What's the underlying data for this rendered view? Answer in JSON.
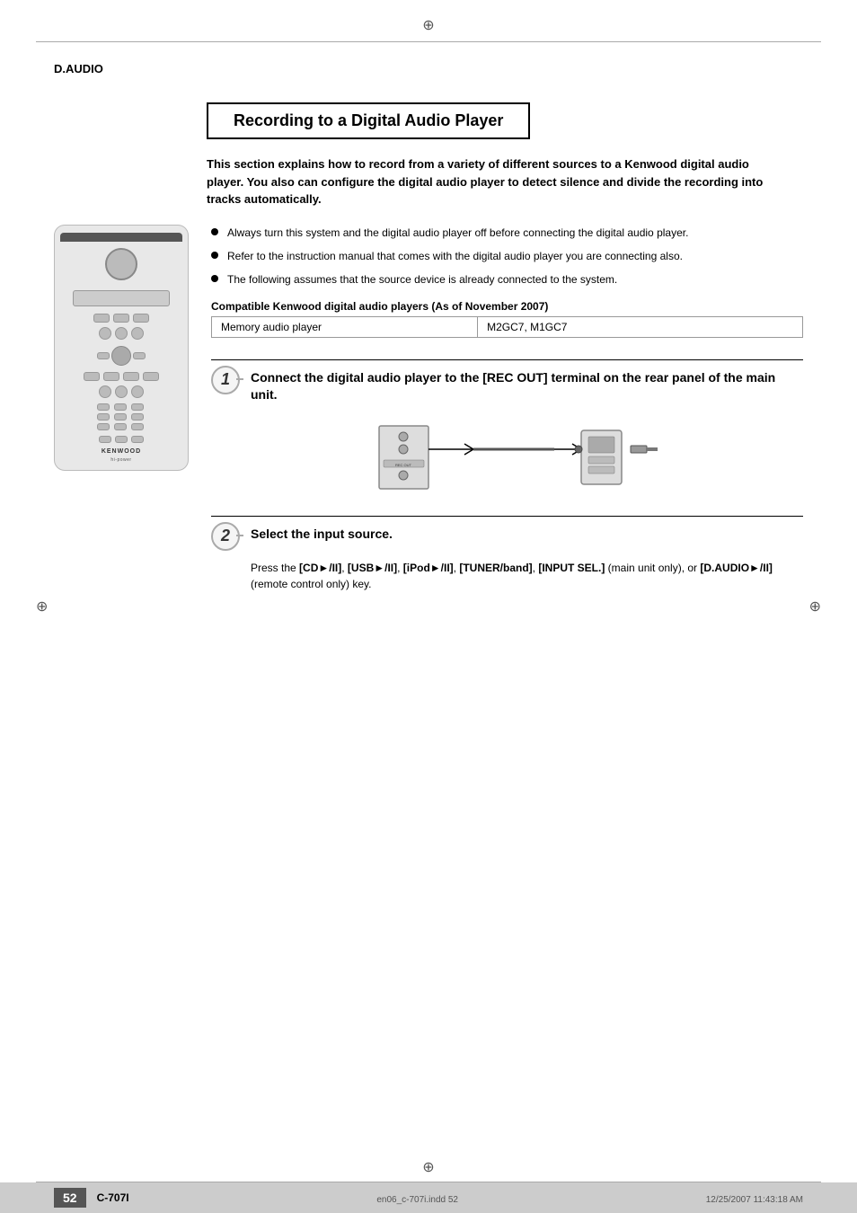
{
  "page": {
    "top_mark": "⊕",
    "left_reg": "⊕",
    "right_reg": "⊕",
    "header_label": "D.AUDIO"
  },
  "title_box": {
    "title": "Recording to a Digital Audio Player"
  },
  "intro": {
    "text": "This section explains how to record from a variety of different sources to a Kenwood digital audio player. You also can configure the digital audio player to detect silence and divide the recording into tracks automatically."
  },
  "bullets": [
    "Always turn this system and the digital audio player off before connecting the digital audio player.",
    "Refer to the instruction manual that comes with the digital audio player you are connecting also.",
    "The following assumes that the source device is already connected to the system."
  ],
  "compat": {
    "label": "Compatible Kenwood digital audio players (As of November 2007)",
    "rows": [
      {
        "type": "Memory audio player",
        "model": "M2GC7, M1GC7"
      }
    ]
  },
  "steps": [
    {
      "number": "1",
      "title": "Connect the digital audio player to the [REC OUT] terminal on the rear panel of the main unit.",
      "body": ""
    },
    {
      "number": "2",
      "title": "Select the input source.",
      "body": "Press the [CD►/II], [USB►/II], [iPod►/II], [TUNER/band], [INPUT SEL.] (main unit only), or [D.AUDIO►/II] (remote control only) key."
    }
  ],
  "footer": {
    "page_number": "52",
    "model": "C-707I",
    "file": "en06_c-707i.indd  52",
    "date": "12/25/2007  11:43:18 AM",
    "bottom_mark": "⊕"
  }
}
